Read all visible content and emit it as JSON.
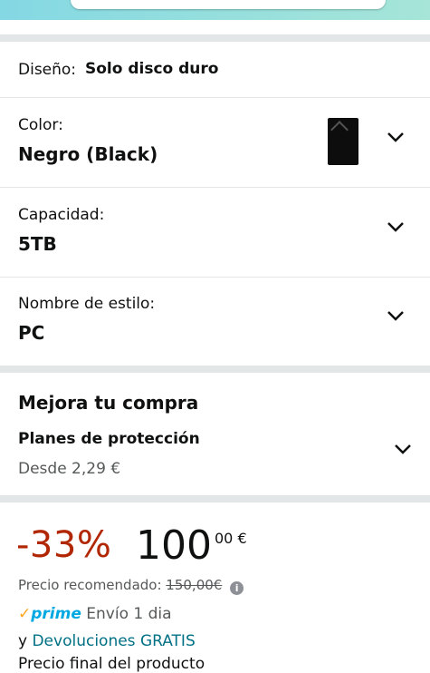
{
  "options": {
    "design": {
      "label": "Diseño:",
      "value": "Solo disco duro"
    },
    "color": {
      "label": "Color:",
      "value": "Negro (Black)",
      "thumbnail_icon": "hard-drive-black-thumbnail"
    },
    "capacity": {
      "label": "Capacidad:",
      "value": "5TB"
    },
    "style": {
      "label": "Nombre de estilo:",
      "value": "PC"
    }
  },
  "upgrade": {
    "title": "Mejora tu compra",
    "plan_title": "Planes de protección",
    "plan_price": "Desde 2,29 €"
  },
  "pricing": {
    "discount": "-33%",
    "price_whole": "100",
    "price_fraction": "00 €",
    "rrp_label": "Precio recomendado:",
    "rrp_value": "150,00€",
    "info_icon": "i"
  },
  "delivery": {
    "prime_check": "✓",
    "prime_label": "prime",
    "shipping_text": "Envío 1 dia",
    "returns_prefix": "y",
    "returns_link": "Devoluciones GRATIS",
    "final_price_text": "Precio final del producto"
  },
  "colors": {
    "discount": "#b12704",
    "link": "#007185",
    "prime": "#00a8e1",
    "prime_check": "#ffa41c",
    "divider": "#e3e6e6"
  }
}
